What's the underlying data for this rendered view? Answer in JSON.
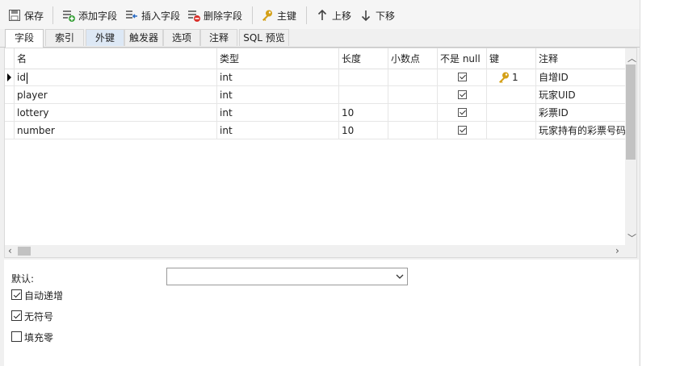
{
  "toolbar": {
    "save": "保存",
    "add_field": "添加字段",
    "insert_field": "插入字段",
    "delete_field": "删除字段",
    "primary_key": "主键",
    "move_up": "上移",
    "move_down": "下移"
  },
  "tabs": [
    "字段",
    "索引",
    "外键",
    "触发器",
    "选项",
    "注释",
    "SQL 预览"
  ],
  "grid": {
    "headers": [
      "名",
      "类型",
      "长度",
      "小数点",
      "不是 null",
      "键",
      "注释"
    ],
    "rows": [
      {
        "name": "id",
        "type": "int",
        "length": "",
        "decimal": "",
        "not_null": true,
        "key": "1",
        "comment": "自增ID"
      },
      {
        "name": "player",
        "type": "int",
        "length": "",
        "decimal": "",
        "not_null": true,
        "key": "",
        "comment": "玩家UID"
      },
      {
        "name": "lottery",
        "type": "int",
        "length": "10",
        "decimal": "",
        "not_null": true,
        "key": "",
        "comment": "彩票ID"
      },
      {
        "name": "number",
        "type": "int",
        "length": "10",
        "decimal": "",
        "not_null": true,
        "key": "",
        "comment": "玩家持有的彩票号码"
      }
    ]
  },
  "props": {
    "default_label": "默认:",
    "default_value": "",
    "auto_increment_label": "自动递增",
    "auto_increment": true,
    "unsigned_label": "无符号",
    "unsigned": true,
    "zerofill_label": "填充零",
    "zerofill": false
  },
  "colors": {
    "key_icon": "#d4a017",
    "delete_red": "#d9302b",
    "add_green": "#3aa13a"
  }
}
